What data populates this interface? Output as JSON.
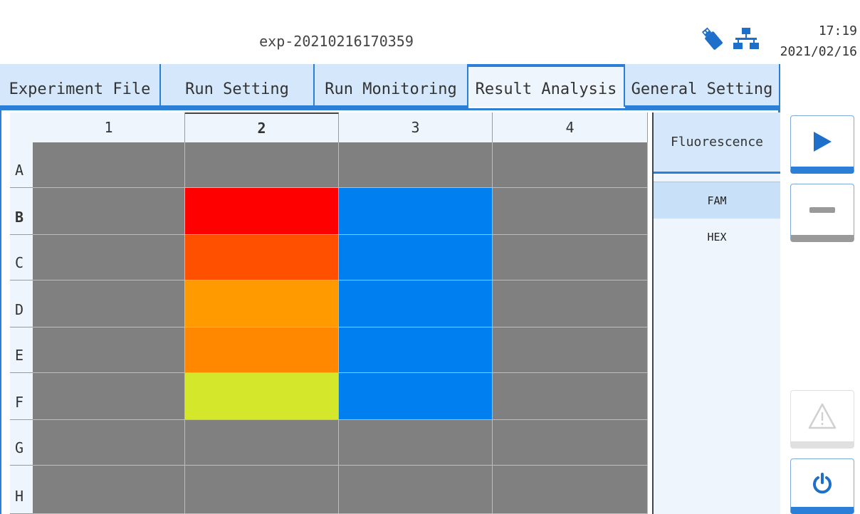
{
  "header": {
    "title": "exp-20210216170359",
    "time": "17:19",
    "date": "2021/02/16",
    "icons": [
      "usb-icon",
      "network-icon"
    ]
  },
  "tabs": [
    {
      "label": "Experiment File",
      "active": false
    },
    {
      "label": "Run Setting",
      "active": false
    },
    {
      "label": "Run Monitoring",
      "active": false
    },
    {
      "label": "Result Analysis",
      "active": true
    },
    {
      "label": "General Setting",
      "active": false
    }
  ],
  "plate": {
    "columns": [
      "1",
      "2",
      "3",
      "4"
    ],
    "rows": [
      "A",
      "B",
      "C",
      "D",
      "E",
      "F",
      "G",
      "H"
    ],
    "selected_column": "2",
    "selected_row": "B",
    "well_colors": [
      [
        "#808080",
        "#808080",
        "#808080",
        "#808080"
      ],
      [
        "#808080",
        "#ff0000",
        "#0080f0",
        "#808080"
      ],
      [
        "#808080",
        "#ff5000",
        "#0080f0",
        "#808080"
      ],
      [
        "#808080",
        "#ff9a00",
        "#0080f0",
        "#808080"
      ],
      [
        "#808080",
        "#ff8800",
        "#0080f0",
        "#808080"
      ],
      [
        "#808080",
        "#d4e72a",
        "#0080f0",
        "#808080"
      ],
      [
        "#808080",
        "#808080",
        "#808080",
        "#808080"
      ],
      [
        "#808080",
        "#808080",
        "#808080",
        "#808080"
      ]
    ]
  },
  "side_panel": {
    "fluorescence_label": "Fluorescence",
    "dyes": [
      {
        "label": "FAM",
        "selected": true
      },
      {
        "label": "HEX",
        "selected": false
      }
    ]
  },
  "controls": {
    "buttons": [
      "play-icon",
      "minus-icon",
      "warning-icon",
      "power-icon"
    ],
    "accent": "#2b7fd6"
  }
}
